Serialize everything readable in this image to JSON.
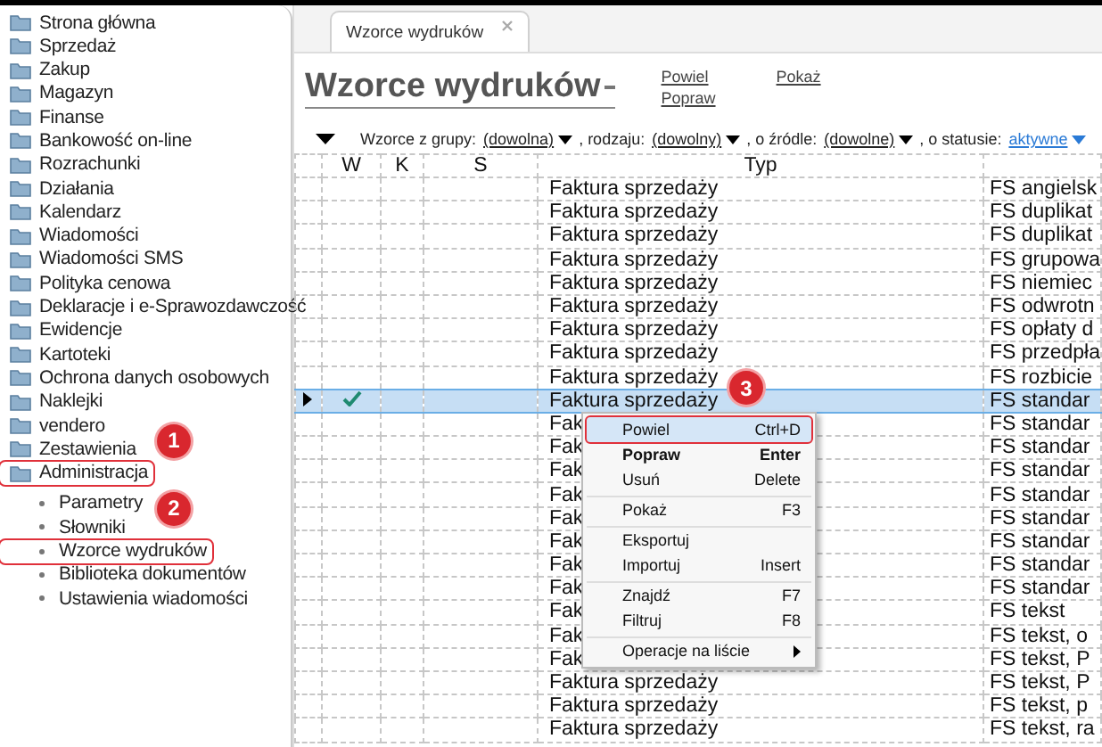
{
  "sidebar": {
    "items": [
      {
        "label": "Strona główna"
      },
      {
        "label": "Sprzedaż"
      },
      {
        "label": "Zakup"
      },
      {
        "label": "Magazyn"
      },
      {
        "label": "Finanse"
      },
      {
        "label": "Bankowość on-line"
      },
      {
        "label": "Rozrachunki"
      },
      {
        "label": "Działania"
      },
      {
        "label": "Kalendarz"
      },
      {
        "label": "Wiadomości"
      },
      {
        "label": "Wiadomości SMS"
      },
      {
        "label": "Polityka cenowa"
      },
      {
        "label": "Deklaracje i e-Sprawozdawczość"
      },
      {
        "label": "Ewidencje"
      },
      {
        "label": "Kartoteki"
      },
      {
        "label": "Ochrona danych osobowych"
      },
      {
        "label": "Naklejki"
      },
      {
        "label": "vendero"
      },
      {
        "label": "Zestawienia"
      },
      {
        "label": "Administracja",
        "callout": true,
        "marker": "1",
        "children": [
          {
            "label": "Parametry"
          },
          {
            "label": "Słowniki"
          },
          {
            "label": "Wzorce wydruków",
            "callout": true,
            "marker": "2"
          },
          {
            "label": "Biblioteka dokumentów"
          },
          {
            "label": "Ustawienia wiadomości"
          }
        ]
      }
    ]
  },
  "tabs": [
    {
      "label": "Wzorce wydruków",
      "selected": true
    }
  ],
  "header": {
    "title": "Wzorce wydruków",
    "actions": [
      "Powiel",
      "Popraw",
      "Pokaż"
    ]
  },
  "filters": [
    {
      "label": "Wzorce z grupy:",
      "value": "(dowolna)",
      "accent": false
    },
    {
      "label": ", rodzaju:",
      "value": "(dowolny)",
      "accent": false
    },
    {
      "label": ", o źródle:",
      "value": "(dowolne)",
      "accent": false
    },
    {
      "label": ", o statusie:",
      "value": "aktywne",
      "accent": true
    }
  ],
  "table": {
    "columns": [
      "W",
      "K",
      "S",
      "Typ"
    ],
    "rows": [
      {
        "selected": false,
        "checked": false,
        "type": "Faktura sprzedaży",
        "column_6": "FS angielsk"
      },
      {
        "selected": false,
        "checked": false,
        "type": "Faktura sprzedaży",
        "column_6": "FS duplikat"
      },
      {
        "selected": false,
        "checked": false,
        "type": "Faktura sprzedaży",
        "column_6": "FS duplikat"
      },
      {
        "selected": false,
        "checked": false,
        "type": "Faktura sprzedaży",
        "column_6": "FS grupowa"
      },
      {
        "selected": false,
        "checked": false,
        "type": "Faktura sprzedaży",
        "column_6": "FS niemiec"
      },
      {
        "selected": false,
        "checked": false,
        "type": "Faktura sprzedaży",
        "column_6": "FS odwrotn"
      },
      {
        "selected": false,
        "checked": false,
        "type": "Faktura sprzedaży",
        "column_6": "FS opłaty d"
      },
      {
        "selected": false,
        "checked": false,
        "type": "Faktura sprzedaży",
        "column_6": "FS przedpła"
      },
      {
        "selected": false,
        "checked": false,
        "type": "Faktura sprzedaży",
        "column_6": "FS rozbicie"
      },
      {
        "selected": true,
        "checked": true,
        "type": "Faktura sprzedaży",
        "column_6": "FS standar"
      },
      {
        "selected": false,
        "checked": false,
        "type": "Fak",
        "column_6": "FS standar"
      },
      {
        "selected": false,
        "checked": false,
        "type": "Fak",
        "column_6": "FS standar"
      },
      {
        "selected": false,
        "checked": false,
        "type": "Fak",
        "column_6": "FS standar"
      },
      {
        "selected": false,
        "checked": false,
        "type": "Fak",
        "column_6": "FS standar"
      },
      {
        "selected": false,
        "checked": false,
        "type": "Fak",
        "column_6": "FS standar"
      },
      {
        "selected": false,
        "checked": false,
        "type": "Fak",
        "column_6": "FS standar"
      },
      {
        "selected": false,
        "checked": false,
        "type": "Fak",
        "column_6": "FS standar"
      },
      {
        "selected": false,
        "checked": false,
        "type": "Fak",
        "column_6": "FS standar"
      },
      {
        "selected": false,
        "checked": false,
        "type": "Fak",
        "column_6": "FS tekst"
      },
      {
        "selected": false,
        "checked": false,
        "type": "Fak",
        "column_6": "FS tekst, o"
      },
      {
        "selected": false,
        "checked": false,
        "type": "Fak",
        "column_6": "FS tekst, P"
      },
      {
        "selected": false,
        "checked": false,
        "type": "Faktura sprzedaży",
        "column_6": "FS tekst, P"
      },
      {
        "selected": false,
        "checked": false,
        "type": "Faktura sprzedaży",
        "column_6": "FS tekst, p"
      },
      {
        "selected": false,
        "checked": false,
        "type": "Faktura sprzedaży",
        "column_6": "FS tekst, ra"
      }
    ]
  },
  "context_menu": {
    "items": [
      {
        "label": "Powiel",
        "shortcut": "Ctrl+D",
        "bold": false,
        "selected": true,
        "callout": true,
        "marker": "3",
        "separator_before": false,
        "submenu": false
      },
      {
        "label": "Popraw",
        "shortcut": "Enter",
        "bold": true,
        "selected": false,
        "separator_before": false,
        "submenu": false
      },
      {
        "label": "Usuń",
        "shortcut": "Delete",
        "bold": false,
        "selected": false,
        "separator_before": false,
        "submenu": false
      },
      {
        "label": "Pokaż",
        "shortcut": "F3",
        "bold": false,
        "selected": false,
        "separator_before": true,
        "submenu": false
      },
      {
        "label": "Eksportuj",
        "bold": false,
        "selected": false,
        "separator_before": true,
        "submenu": false
      },
      {
        "label": "Importuj",
        "shortcut": "Insert",
        "bold": false,
        "selected": false,
        "separator_before": false,
        "submenu": false
      },
      {
        "label": "Znajdź",
        "shortcut": "F7",
        "bold": false,
        "selected": false,
        "separator_before": true,
        "submenu": false
      },
      {
        "label": "Filtruj",
        "shortcut": "F8",
        "bold": false,
        "selected": false,
        "separator_before": false,
        "submenu": false
      },
      {
        "label": "Operacje na liście",
        "bold": false,
        "selected": false,
        "separator_before": true,
        "submenu": true
      }
    ]
  }
}
